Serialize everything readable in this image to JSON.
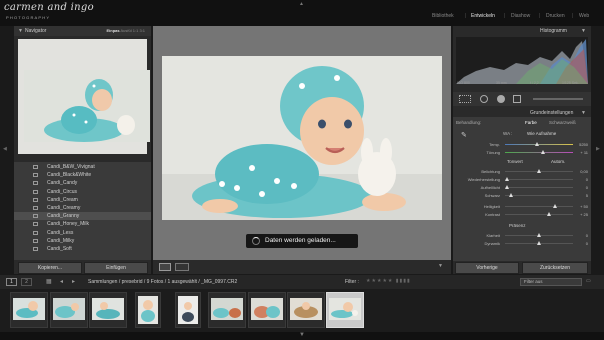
{
  "brand": {
    "name": "carmen and ingo",
    "tagline": "PHOTOGRAPHY"
  },
  "modules": [
    "Bibliothek",
    "Entwickeln",
    "Diashow",
    "Drucken",
    "Web"
  ],
  "active_module": "Entwickeln",
  "navigator": {
    "title": "Navigator",
    "options": [
      "Einpas",
      "Ausfül",
      "1:1",
      "3:1"
    ]
  },
  "presets": [
    "Candi_B&W_Vivignat",
    "Candi_Black&White",
    "Candi_Candy",
    "Candi_Circus",
    "Candi_Cream",
    "Candi_Creamy",
    "Candi_Granny",
    "Candi_Honey_Milk",
    "Candi_Less",
    "Candi_Milky",
    "Candi_Soft"
  ],
  "selected_preset": "Candi_Granny",
  "left_buttons": {
    "copy": "Kopieren...",
    "paste": "Einfügen"
  },
  "loading_text": "Daten werden geladen...",
  "histogram": {
    "title": "Histogramm",
    "iso": "ISO 800",
    "focal": "35 mm",
    "aperture": "f / 2,2",
    "shutter": "1/125 Sek."
  },
  "basic": {
    "title": "Grundeinstellungen",
    "treatment_label": "Behandlung:",
    "treatment_color": "Farbe",
    "treatment_bw": "Schwarzweiß",
    "wb_label": "WA :",
    "wb_value": "Wie Aufnahme",
    "sliders": [
      {
        "label": "Temp.",
        "value": "5250"
      },
      {
        "label": "Tönung",
        "value": "+ 11"
      }
    ],
    "tone_label": "Tonwert",
    "auto_label": "Autom.",
    "tone_sliders": [
      {
        "label": "Belichtung",
        "value": "0,00"
      },
      {
        "label": "Wiederherstellung",
        "value": "0"
      },
      {
        "label": "Aufhelllicht",
        "value": "0"
      },
      {
        "label": "Schwarz",
        "value": "5"
      },
      {
        "label": "Helligkeit",
        "value": "+ 50"
      },
      {
        "label": "Kontrast",
        "value": "+ 25"
      }
    ],
    "presence_label": "Präsenz",
    "presence_sliders": [
      {
        "label": "Klarheit",
        "value": "0"
      },
      {
        "label": "Dynamik",
        "value": "0"
      }
    ]
  },
  "right_buttons": {
    "previous": "Vorherige",
    "reset": "Zurücksetzen"
  },
  "filmstrip_bar": {
    "monitor1": "1",
    "monitor2": "2",
    "path": "Sammlungen / presebrid / 9 Fotos / 1 ausgewählt / _MG_0997.CR2",
    "filter_label": "Filter :",
    "filter_value": "Filter aus"
  },
  "thumbnails": 9,
  "selected_thumb": 8,
  "colors": {
    "accent": "#e6e6e6",
    "panel": "#2a2a2a",
    "selection": "#c9c9c9"
  }
}
